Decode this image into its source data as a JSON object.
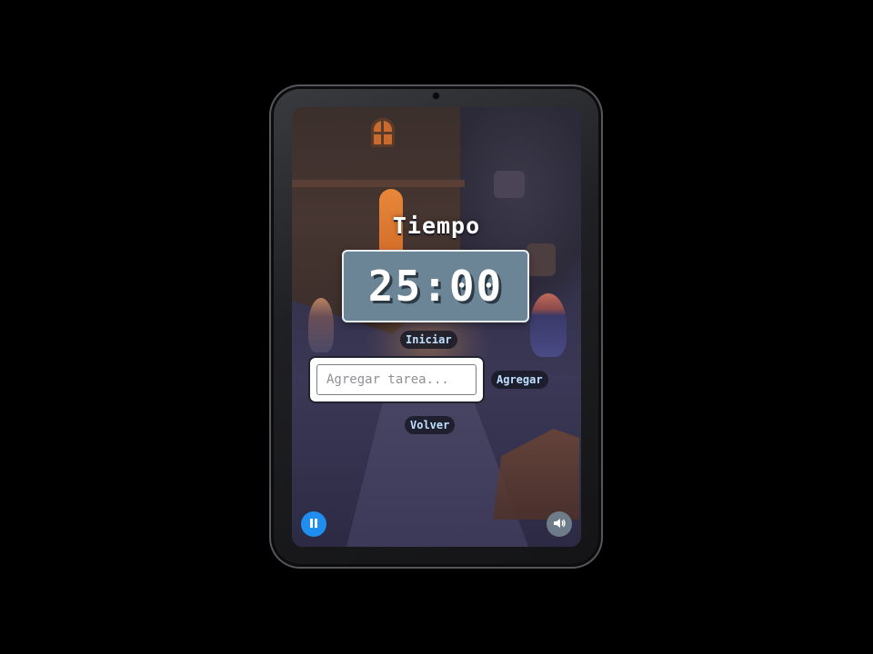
{
  "app": {
    "title": "Tiempo"
  },
  "timer": {
    "display": "25:00"
  },
  "controls": {
    "start_label": "Iniciar",
    "add_label": "Agregar",
    "back_label": "Volver"
  },
  "task": {
    "placeholder": "Agregar tarea...",
    "value": ""
  },
  "media": {
    "pause_icon": "pause-icon",
    "sound_icon": "speaker-icon"
  },
  "colors": {
    "timer_bg": "#6b8597",
    "pause_button": "#1e8ef0",
    "sound_button": "#6d7c88",
    "button_text": "#bfe0ff"
  }
}
